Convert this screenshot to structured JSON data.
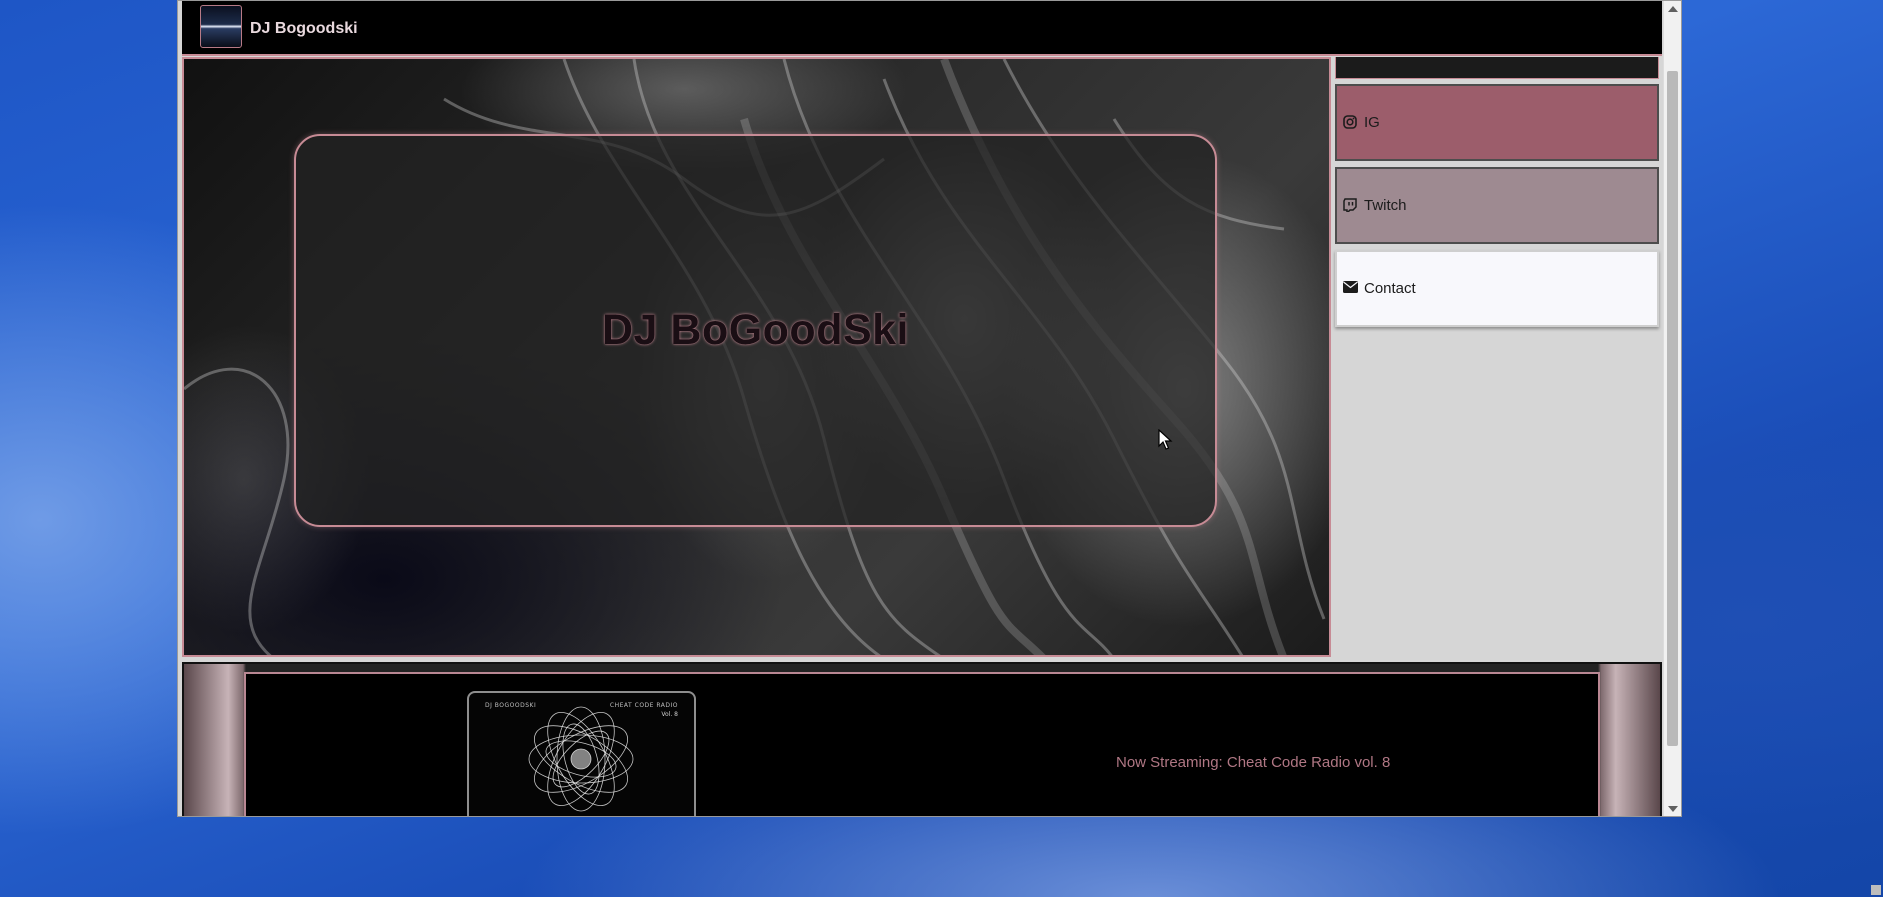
{
  "header": {
    "brand": "DJ Bogoodski",
    "logo_icon": "waveform-logo-icon"
  },
  "hero": {
    "title": "DJ BoGoodSki"
  },
  "sidebar": {
    "items": [
      {
        "label": "IG",
        "icon": "instagram-icon"
      },
      {
        "label": "Twitch",
        "icon": "twitch-icon"
      },
      {
        "label": "Contact",
        "icon": "envelope-icon"
      }
    ]
  },
  "footer": {
    "album": {
      "artist": "DJ BOGOODSKI",
      "title": "CHEAT CODE RADIO",
      "volume": "Vol. 8"
    },
    "now_streaming": "Now Streaming: Cheat Code Radio vol. 8"
  },
  "colors": {
    "accent": "#c78b95",
    "ig_bg": "#9c5d6b",
    "twitch_bg": "#9e8a91",
    "contact_bg": "#f8f8fc",
    "stream_text": "#b07784"
  }
}
